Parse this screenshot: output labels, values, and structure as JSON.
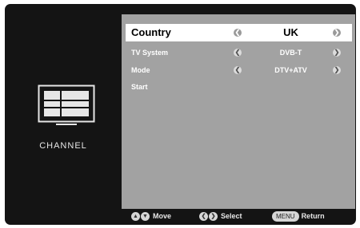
{
  "sidebar": {
    "label": "CHANNEL",
    "icon": "tv-icon"
  },
  "menu": {
    "rows": [
      {
        "label": "Country",
        "value": "UK",
        "selected": true,
        "has_arrows": true
      },
      {
        "label": "TV System",
        "value": "DVB-T",
        "selected": false,
        "has_arrows": true
      },
      {
        "label": "Mode",
        "value": "DTV+ATV",
        "selected": false,
        "has_arrows": true
      },
      {
        "label": "Start",
        "value": "",
        "selected": false,
        "has_arrows": false
      }
    ]
  },
  "footer": {
    "move_label": "Move",
    "select_label": "Select",
    "menu_key_label": "MENU",
    "return_label": "Return"
  },
  "colors": {
    "panel": "#a2a2a2",
    "frame": "#141414",
    "selected_row": "#ffffff"
  }
}
